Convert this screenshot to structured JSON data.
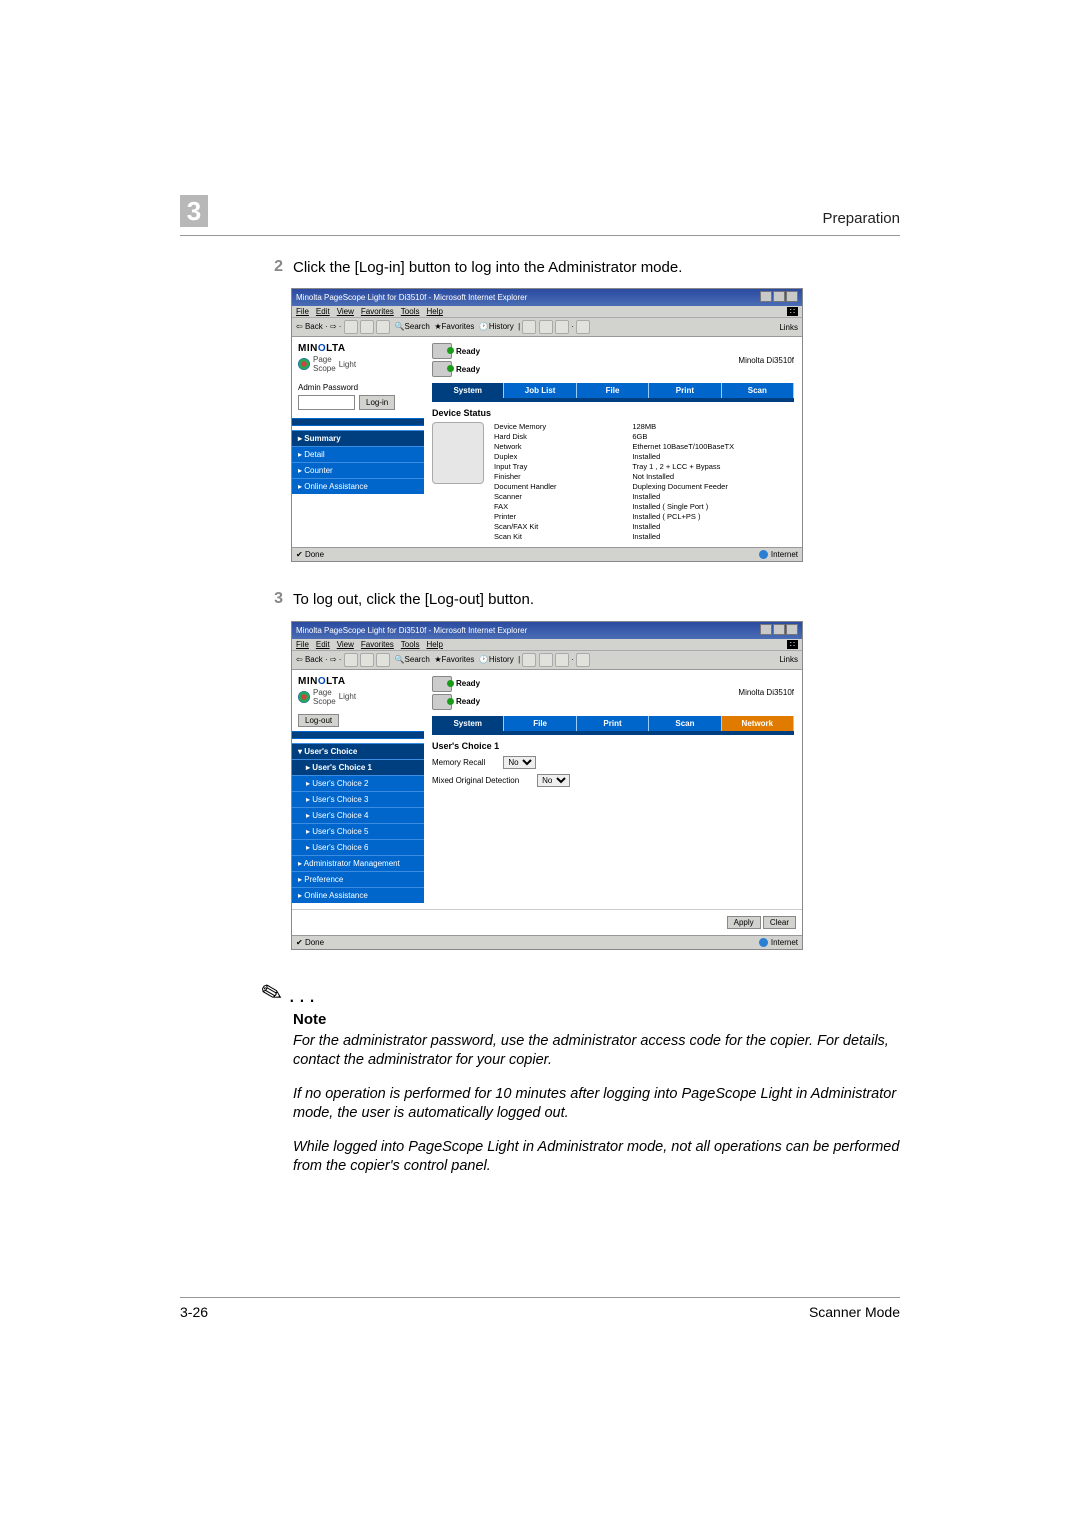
{
  "header": {
    "chapter": "3",
    "title": "Preparation"
  },
  "steps": {
    "s2_num": "2",
    "s2_text": "Click the [Log-in] button to log into the Administrator mode.",
    "s3_num": "3",
    "s3_text": "To log out, click the [Log-out] button."
  },
  "ie": {
    "title": "Minolta PageScope Light for Di3510f - Microsoft Internet Explorer",
    "menu": {
      "file": "File",
      "edit": "Edit",
      "view": "View",
      "fav": "Favorites",
      "tools": "Tools",
      "help": "Help"
    },
    "links": "Links",
    "back": "Back",
    "search": "Search",
    "favorites": "Favorites",
    "history": "History",
    "done": "Done",
    "internet": "Internet"
  },
  "shot1": {
    "logo_light": "Light",
    "ready": "Ready",
    "model": "Minolta Di3510f",
    "pw_label": "Admin Password",
    "login": "Log-in",
    "tabs": {
      "system": "System",
      "joblist": "Job List",
      "file": "File",
      "print": "Print",
      "scan": "Scan"
    },
    "nav": {
      "summary": "▸ Summary",
      "detail": "▸ Detail",
      "counter": "▸ Counter",
      "assist": "▸ Online Assistance"
    },
    "panel": "Device Status",
    "kv": {
      "k1": "Device Memory",
      "v1": "128MB",
      "k2": "Hard Disk",
      "v2": "6GB",
      "k3": "Network",
      "v3": "Ethernet 10BaseT/100BaseTX",
      "k4": "Duplex",
      "v4": "Installed",
      "k5": "Input Tray",
      "v5": "Tray 1 , 2 + LCC + Bypass",
      "k6": "Finisher",
      "v6": "Not Installed",
      "k7": "Document Handler",
      "v7": "Duplexing Document Feeder",
      "k8": "Scanner",
      "v8": "Installed",
      "k9": "FAX",
      "v9": "Installed ( Single Port )",
      "k10": "Printer",
      "v10": "Installed ( PCL+PS )",
      "k11": "Scan/FAX Kit",
      "v11": "Installed",
      "k12": "Scan Kit",
      "v12": "Installed"
    }
  },
  "shot2": {
    "logout": "Log-out",
    "tabs": {
      "system": "System",
      "file": "File",
      "print": "Print",
      "scan": "Scan",
      "network": "Network"
    },
    "nav": {
      "uc": "▾ User's Choice",
      "uc1": "▸ User's Choice 1",
      "uc2": "▸ User's Choice 2",
      "uc3": "▸ User's Choice 3",
      "uc4": "▸ User's Choice 4",
      "uc5": "▸ User's Choice 5",
      "uc6": "▸ User's Choice 6",
      "admin": "▸ Administrator Management",
      "pref": "▸ Preference",
      "assist": "▸ Online Assistance"
    },
    "panel": "User's Choice 1",
    "opt1_label": "Memory Recall",
    "opt1_val": "No",
    "opt2_label": "Mixed Original Detection",
    "opt2_val": "No",
    "apply": "Apply",
    "clear": "Clear"
  },
  "note": {
    "heading": "Note",
    "p1": "For the administrator password, use the administrator access code for the copier. For details, contact the administrator for your copier.",
    "p2": "If no operation is performed for 10 minutes after logging into PageScope Light in Administrator mode, the user is automatically logged out.",
    "p3": "While logged into PageScope Light in Administrator mode, not all operations can be performed from the copier's control panel."
  },
  "footer": {
    "left": "3-26",
    "right": "Scanner Mode"
  }
}
